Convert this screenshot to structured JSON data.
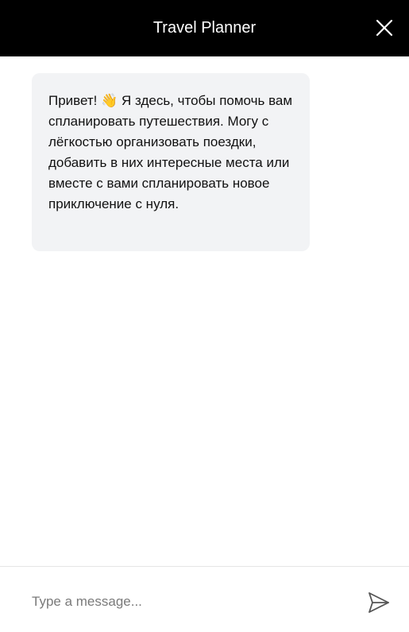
{
  "header": {
    "title": "Travel Planner"
  },
  "messages": [
    {
      "sender": "assistant",
      "text": "Привет! 👋 Я здесь, чтобы помочь вам спланировать путешествия. Могу с лёгкостью организовать поездки, добавить в них интересные места или вместе с вами спланировать новое приключение с нуля."
    }
  ],
  "composer": {
    "placeholder": "Type a message...",
    "value": ""
  },
  "icons": {
    "close": "close-icon",
    "send": "send-icon"
  },
  "colors": {
    "header_bg": "#000000",
    "header_text": "#ffffff",
    "bubble_bg": "#f2f3f5",
    "page_bg": "#ffffff"
  }
}
